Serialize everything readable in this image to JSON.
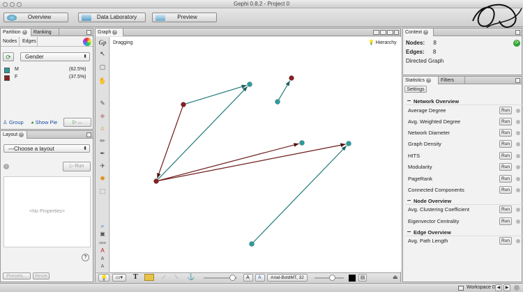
{
  "window": {
    "title": "Gephi 0.8.2 - Project 0"
  },
  "modes": [
    {
      "label": "Overview"
    },
    {
      "label": "Data Laboratory"
    },
    {
      "label": "Preview"
    }
  ],
  "partition": {
    "tabs": [
      "Partition",
      "Ranking"
    ],
    "subtabs": [
      "Nodes",
      "Edges"
    ],
    "attribute": "Gender",
    "entries": [
      {
        "label": "M",
        "percent": "(62.5%)",
        "color": "#2a9d9d"
      },
      {
        "label": "F",
        "percent": "(37.5%)",
        "color": "#8b1e1e"
      }
    ],
    "group_label": "Group",
    "show_pie_label": "Show Pie",
    "apply_label": "..."
  },
  "layout": {
    "tab": "Layout",
    "choose": "---Choose a layout",
    "run": "Run",
    "no_properties": "<No Properties>",
    "presets": "Presets...",
    "reset": "Reset"
  },
  "graph": {
    "tab": "Graph",
    "tool_status": "Dragging",
    "hierarchy": "Hierarchy",
    "font_name": "Arial-BoldMT, 32",
    "size_label": "size",
    "node_colors": {
      "male": "#2a9d9d",
      "female": "#8b1e1e"
    },
    "edges": [
      {
        "from": "f1",
        "to": "m1",
        "color": "#1f7a7a"
      },
      {
        "from": "m2",
        "to": "f2",
        "color": "#1f7a7a"
      },
      {
        "from": "f1",
        "to": "f3",
        "color": "#6b1a1a"
      },
      {
        "from": "f3",
        "to": "m1",
        "color": "#1f7a7a"
      },
      {
        "from": "f3",
        "to": "m3",
        "color": "#6b1a1a"
      },
      {
        "from": "f3",
        "to": "m4",
        "color": "#6b1a1a"
      },
      {
        "from": "m5",
        "to": "m4",
        "color": "#1f7a7a"
      }
    ]
  },
  "context": {
    "tab": "Context",
    "nodes_label": "Nodes:",
    "nodes_value": "8",
    "edges_label": "Edges:",
    "edges_value": "8",
    "graph_type": "Directed Graph"
  },
  "statistics": {
    "tabs": [
      "Statistics",
      "Filters"
    ],
    "settings": "Settings",
    "run_label": "Run",
    "sections": [
      {
        "title": "Network Overview",
        "items": [
          "Average Degree",
          "Avg. Weighted Degree",
          "Network Diameter",
          "Graph Density",
          "HITS",
          "Modularity",
          "PageRank",
          "Connected Components"
        ]
      },
      {
        "title": "Node Overview",
        "items": [
          "Avg. Clustering Coefficient",
          "Eigenvector Centrality"
        ]
      },
      {
        "title": "Edge Overview",
        "items": [
          "Avg. Path Length"
        ]
      }
    ]
  },
  "statusbar": {
    "workspace": "Workspace 0"
  }
}
